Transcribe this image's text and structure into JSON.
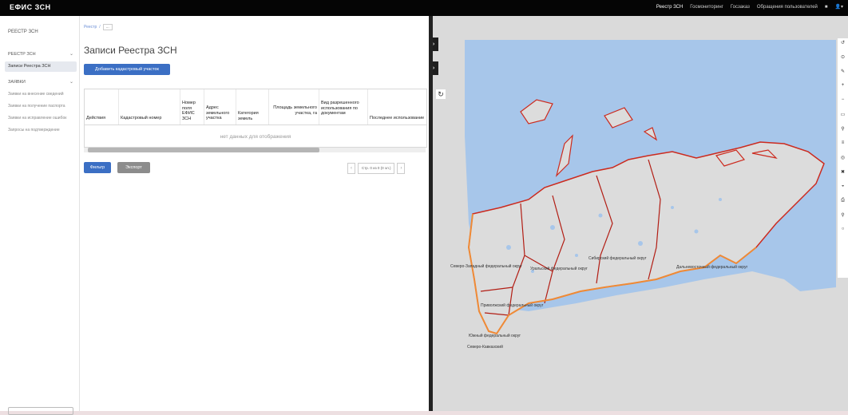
{
  "app": {
    "title": "ЕФИС ЗСН"
  },
  "topnav": {
    "items": [
      "Реестр ЗСН",
      "Госмониторинг",
      "Госзаказ",
      "Обращения пользователей"
    ]
  },
  "sidebar": {
    "title": "РЕЕСТР ЗСН",
    "section1": "РЕЕСТР ЗСН",
    "active_item": "Записи Реестра ЗСН",
    "section2": "ЗАЯВКИ",
    "items": [
      "Заявки на внесение сведений",
      "Заявки на получение паспорта",
      "Заявки на исправление ошибок",
      "Запросы на подтверждение"
    ]
  },
  "breadcrumb": {
    "home": "Реестр",
    "sep": "/",
    "box": "..."
  },
  "main": {
    "title": "Записи Реестра ЗСН",
    "add_button": "Добавить кадастровый участок",
    "no_data": "нет данных для отображения",
    "filter_button": "Фильтр",
    "export_button": "Экспорт",
    "pager_label": "Стр. 0 из 0 (0 эл.)",
    "pager_prev": "‹",
    "pager_next": "›"
  },
  "table": {
    "columns": [
      "Действия",
      "Кадастровый номер",
      "Номер поля ЕФИС ЗСН",
      "Адрес земельного участка",
      "Категория земель",
      "Площадь земельного участка, га",
      "Вид разрешенного использования по документам",
      "Последнее использование"
    ]
  },
  "map": {
    "side_buttons": [
      "»",
      "»"
    ],
    "refresh_icon": "↻",
    "labels": [
      "Северо-Западный федеральный округ",
      "Уральский федеральный округ",
      "Сибирский федеральный округ",
      "Дальневосточный федеральный округ",
      "Приволжский федеральный округ",
      "Южный федеральный округ",
      "Северо-Кавказский"
    ],
    "colors": {
      "water": "#a7c6ea",
      "land": "#dcdcdc",
      "border": "#cc2a1e",
      "outer_border": "#ef8a36"
    },
    "tools": [
      "↺",
      "⊙",
      "✎",
      "+",
      "−",
      "▭",
      "⚲",
      "≡",
      "◎",
      "✖",
      "◒",
      "⎙",
      "⚲",
      "○"
    ]
  }
}
